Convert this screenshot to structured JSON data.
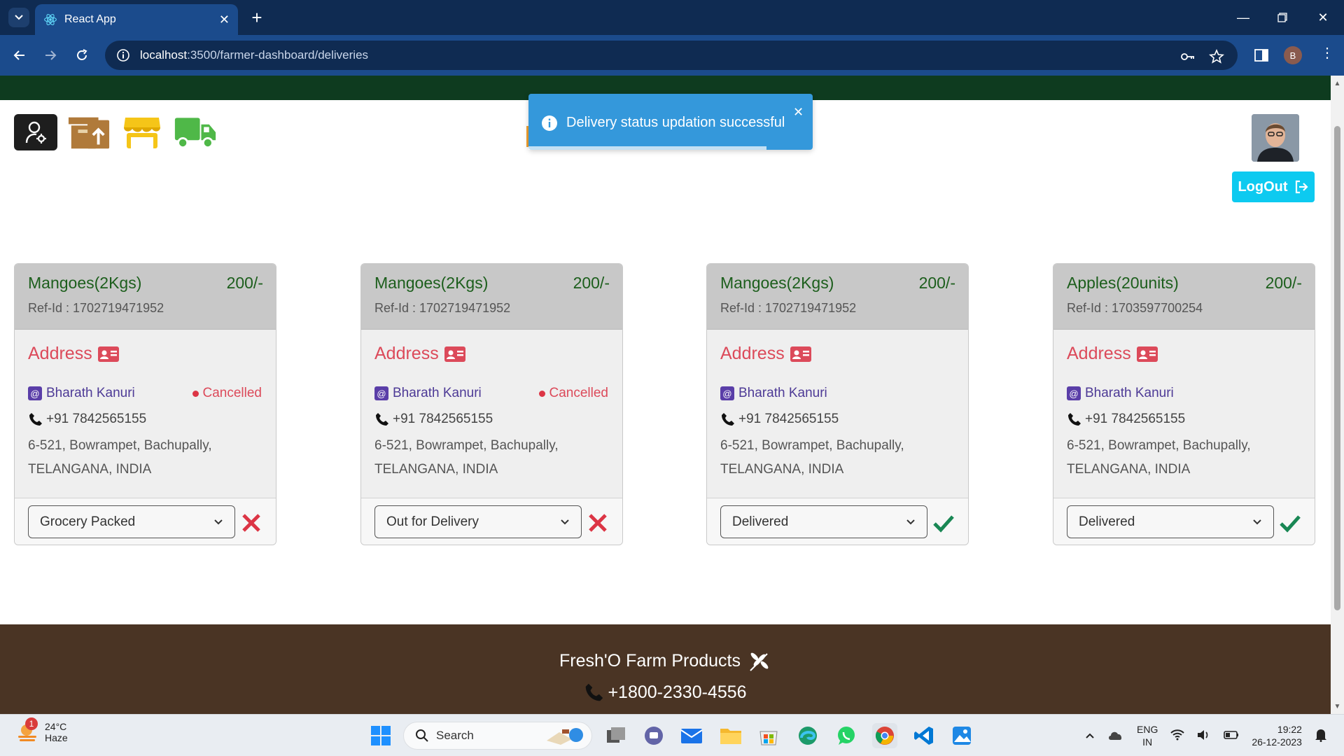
{
  "browser": {
    "tab_title": "React App",
    "url_host": "localhost",
    "url_path": ":3500/farmer-dashboard/deliveries",
    "profile_initial": "B"
  },
  "toast": {
    "message": "Delivery status updation successful"
  },
  "header": {
    "logout_label": "LogOut"
  },
  "cards": [
    {
      "product": "Mangoes(2Kgs)",
      "price": "200/-",
      "ref": "Ref-Id : 1702719471952",
      "address_title": "Address",
      "name": "Bharath Kanuri",
      "status": "Cancelled",
      "phone": "+91 7842565155",
      "address_line1": "6-521, Bowrampet, Bachupally,",
      "address_line2": "TELANGANA, INDIA",
      "selected_status": "Grocery Packed",
      "action": "cancelled-x-icon"
    },
    {
      "product": "Mangoes(2Kgs)",
      "price": "200/-",
      "ref": "Ref-Id : 1702719471952",
      "address_title": "Address",
      "name": "Bharath Kanuri",
      "status": "Cancelled",
      "phone": "+91 7842565155",
      "address_line1": "6-521, Bowrampet, Bachupally,",
      "address_line2": "TELANGANA, INDIA",
      "selected_status": "Out for Delivery",
      "action": "cancelled-x-icon"
    },
    {
      "product": "Mangoes(2Kgs)",
      "price": "200/-",
      "ref": "Ref-Id : 1702719471952",
      "address_title": "Address",
      "name": "Bharath Kanuri",
      "status": "",
      "phone": "+91 7842565155",
      "address_line1": "6-521, Bowrampet, Bachupally,",
      "address_line2": "TELANGANA, INDIA",
      "selected_status": "Delivered",
      "action": "delivered-check-icon"
    },
    {
      "product": "Apples(20units)",
      "price": "200/-",
      "ref": "Ref-Id : 1703597700254",
      "address_title": "Address",
      "name": "Bharath Kanuri",
      "status": "",
      "phone": "+91 7842565155",
      "address_line1": "6-521, Bowrampet, Bachupally,",
      "address_line2": "TELANGANA, INDIA",
      "selected_status": "Delivered",
      "action": "delivered-check-icon"
    }
  ],
  "footer": {
    "brand": "Fresh'O Farm Products",
    "phone": "+1800-2330-4556"
  },
  "taskbar": {
    "weather_temp": "24°C",
    "weather_cond": "Haze",
    "weather_badge": "1",
    "search_label": "Search",
    "lang_top": "ENG",
    "lang_bottom": "IN",
    "time": "19:22",
    "date": "26-12-2023"
  },
  "colors": {
    "accent": "#0dcaf0",
    "toast": "#3498db",
    "title_green": "#1c5e1c",
    "address_red": "#dc4a5a",
    "footer": "#4a3424"
  }
}
